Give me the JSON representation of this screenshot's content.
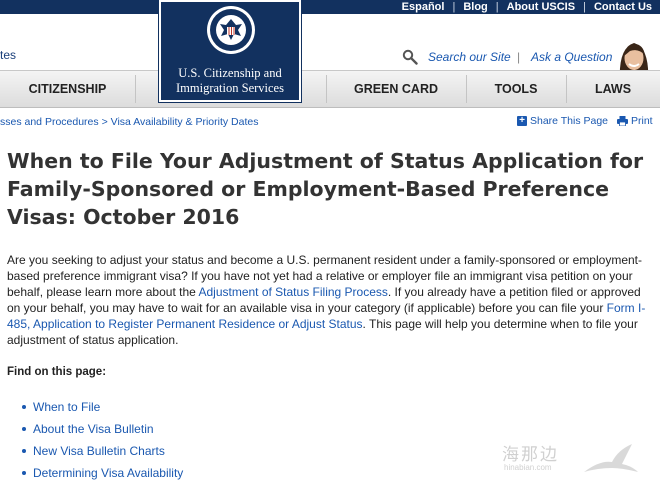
{
  "utility_nav": {
    "espanol": "Español",
    "blog": "Blog",
    "about": "About USCIS",
    "contact": "Contact Us",
    "separator": "|"
  },
  "header": {
    "tagline_fragment": "tes",
    "search_label": "Search our Site",
    "separator": "|",
    "ask_label": "Ask a Question"
  },
  "logo": {
    "line1": "U.S. Citizenship and",
    "line2": "Immigration Services"
  },
  "main_nav": {
    "citizenship": "CITIZENSHIP",
    "green_card": "GREEN CARD",
    "tools": "TOOLS",
    "laws": "LAWS"
  },
  "breadcrumb": {
    "parent": "sses and Procedures",
    "separator": ">",
    "current": "Visa Availability & Priority Dates"
  },
  "page_tools": {
    "share": "Share This Page",
    "print": "Print"
  },
  "page_title": "When to File Your Adjustment of Status Application for Family-Sponsored or Employment-Based Preference Visas: October 2016",
  "intro": {
    "part1": "Are you seeking to adjust your status and become a U.S. permanent resident under a family-sponsored or employment-based preference immigrant visa? If you have not yet had a relative or employer file an immigrant visa petition on your behalf, please learn more about the ",
    "link1": "Adjustment of Status Filing Process",
    "part2": ". If you already have a petition filed or approved on your behalf, you may have to wait for an available visa in your category (if applicable) before you can file your ",
    "link2": "Form I-485, Application to Register Permanent Residence or Adjust Status",
    "part3": ". This page will help you determine when to file your adjustment of status application."
  },
  "find_heading": "Find on this page:",
  "toc": [
    "When to File",
    "About the Visa Bulletin",
    "New Visa Bulletin Charts",
    "Determining Visa Availability"
  ],
  "watermark": {
    "text": "海那边",
    "sub": "hinabian.com"
  },
  "colors": {
    "navy": "#12315f",
    "link": "#1a58b0"
  }
}
